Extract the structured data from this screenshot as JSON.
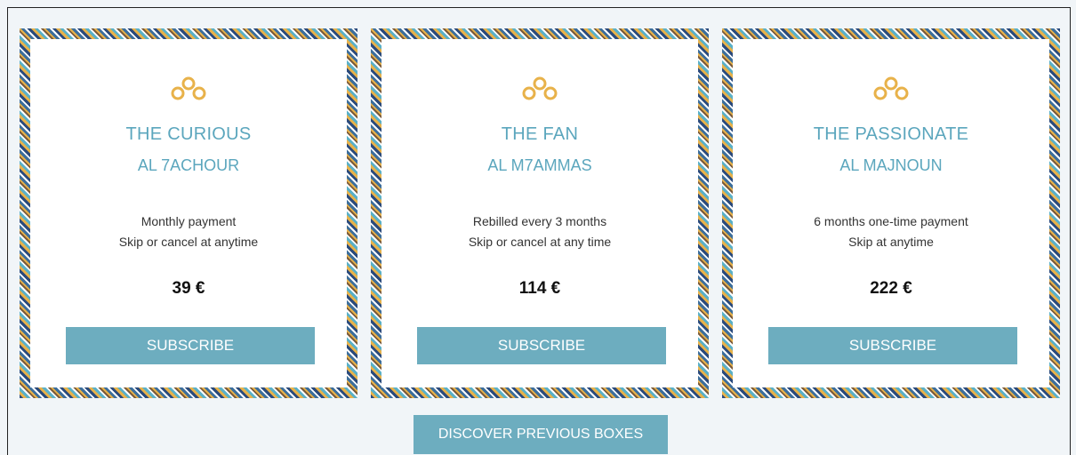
{
  "plans": [
    {
      "title": "THE CURIOUS",
      "subtitle": "AL 7ACHOUR",
      "line1": "Monthly payment",
      "line2": "Skip or cancel at anytime",
      "price": "39 €",
      "button": "SUBSCRIBE"
    },
    {
      "title": "THE FAN",
      "subtitle": "AL M7AMMAS",
      "line1": "Rebilled every 3 months",
      "line2": "Skip or cancel at any time",
      "price": "114 €",
      "button": "SUBSCRIBE"
    },
    {
      "title": "THE PASSIONATE",
      "subtitle": "AL MAJNOUN",
      "line1": "6 months one-time payment",
      "line2": "Skip at anytime",
      "price": "222 €",
      "button": "SUBSCRIBE"
    }
  ],
  "discover_button": "DISCOVER PREVIOUS BOXES",
  "colors": {
    "accent": "#5ba6bd",
    "button": "#6dadbf",
    "icon": "#e8b24a",
    "background": "#f1f5f8"
  },
  "icons": {
    "plan_icon": "knot-icon"
  }
}
